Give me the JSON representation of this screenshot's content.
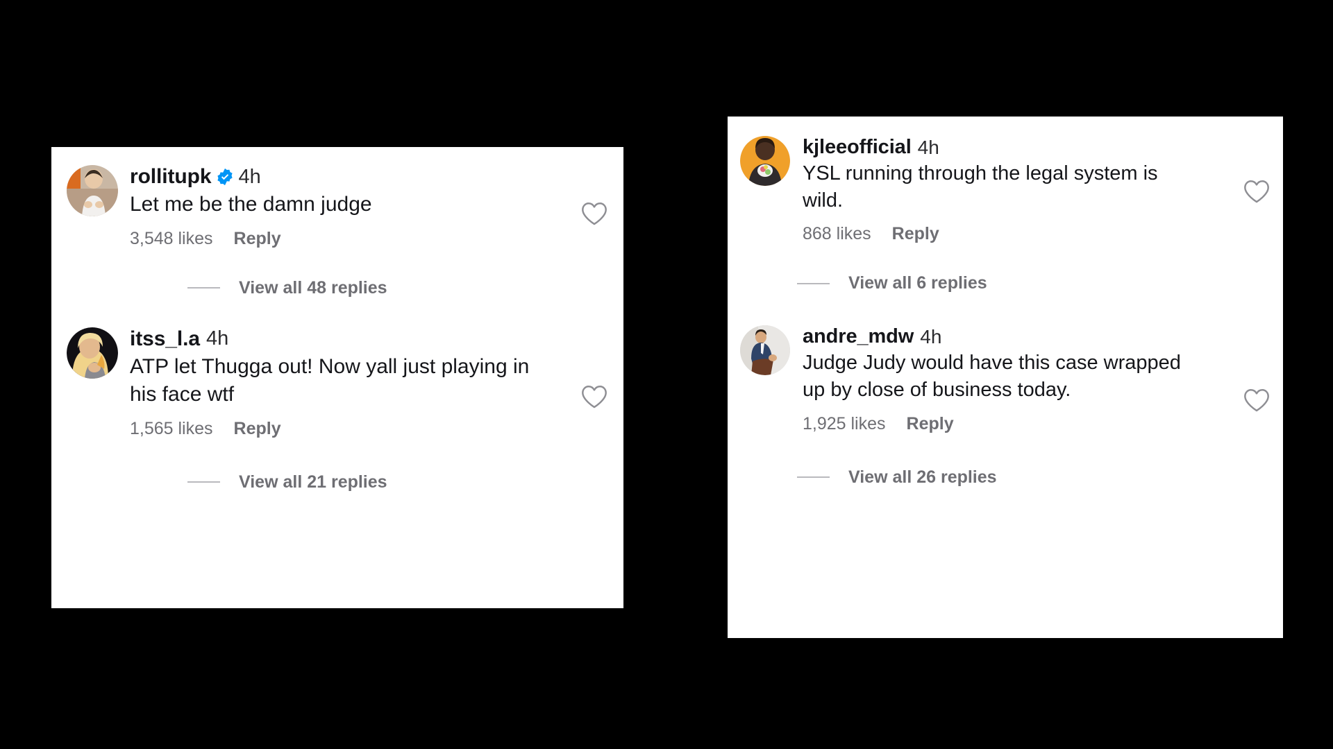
{
  "app": "instagram-comments",
  "colors": {
    "background": "#000000",
    "card_background": "#ffffff",
    "primary_text": "#15161a",
    "secondary_text": "#6e6e73",
    "verified_blue": "#0095f6"
  },
  "cards": [
    {
      "id": "card-left",
      "comments": [
        {
          "username": "rollitupk",
          "verified": true,
          "timestamp": "4h",
          "text": "Let me be the damn judge",
          "likes": "3,548 likes",
          "reply": "Reply",
          "like_icon": "heart-outline-icon",
          "avatar_icon": "avatar-rollitupk",
          "view_replies": "View all 48 replies"
        },
        {
          "username": "itss_l.a",
          "verified": false,
          "timestamp": "4h",
          "text": "ATP let Thugga out! Now yall just playing in his face wtf",
          "likes": "1,565 likes",
          "reply": "Reply",
          "like_icon": "heart-outline-icon",
          "avatar_icon": "avatar-itss-la",
          "view_replies": "View all 21 replies"
        }
      ]
    },
    {
      "id": "card-right",
      "comments": [
        {
          "username": "kjleeofficial",
          "verified": false,
          "timestamp": "4h",
          "text": "YSL running through the legal system is wild.",
          "likes": "868 likes",
          "reply": "Reply",
          "like_icon": "heart-outline-icon",
          "avatar_icon": "avatar-kjleeofficial",
          "view_replies": "View all 6 replies"
        },
        {
          "username": "andre_mdw",
          "verified": false,
          "timestamp": "4h",
          "text": "Judge Judy would have this case wrapped up by close of business today.",
          "likes": "1,925 likes",
          "reply": "Reply",
          "like_icon": "heart-outline-icon",
          "avatar_icon": "avatar-andre-mdw",
          "view_replies": "View all 26 replies"
        }
      ]
    }
  ]
}
